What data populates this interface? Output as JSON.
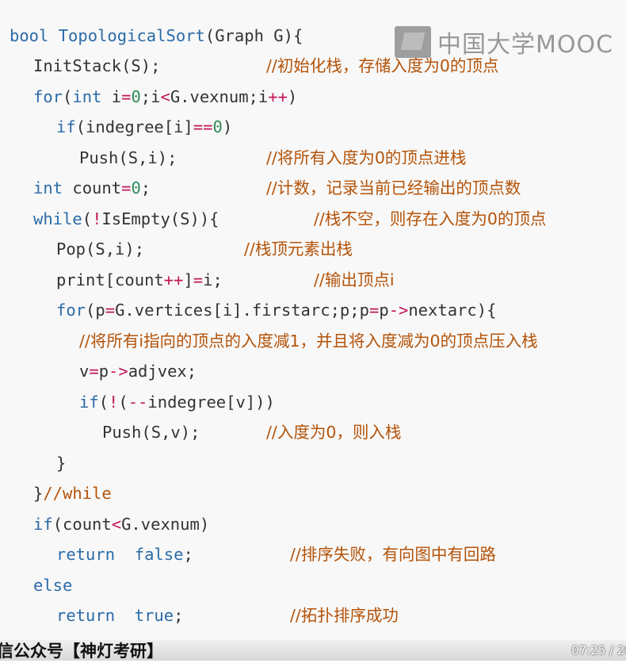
{
  "watermark": {
    "text": "中国大学MOOC"
  },
  "code": {
    "l1_kw": "bool",
    "l1_fn": "TopologicalSort",
    "l1_rest": "(Graph G){",
    "l2_code": "InitStack(S);",
    "l2_comment": "//初始化栈，存储入度为0的顶点",
    "l3_kw": "for",
    "l3_p1": "(",
    "l3_kw2": "int",
    "l3_p2": " i",
    "l3_op1": "=",
    "l3_num1": "0",
    "l3_p3": ";i",
    "l3_op2": "<",
    "l3_p4": "G.vexnum;i",
    "l3_op3": "++",
    "l3_p5": ")",
    "l4_kw": "if",
    "l4_p1": "(indegree[i]",
    "l4_op": "==",
    "l4_num": "0",
    "l4_p2": ")",
    "l5_code": "Push(S,i);",
    "l5_comment": "//将所有入度为0的顶点进栈",
    "l6_kw": "int",
    "l6_p1": " count",
    "l6_op": "=",
    "l6_num": "0",
    "l6_p2": ";",
    "l6_comment": "//计数，记录当前已经输出的顶点数",
    "l7_kw": "while",
    "l7_p1": "(",
    "l7_op": "!",
    "l7_p2": "IsEmpty(S)){",
    "l7_comment": "//栈不空，则存在入度为0的顶点",
    "l8_code": "Pop(S,i);",
    "l8_comment": "//栈顶元素出栈",
    "l9_p1": "print[count",
    "l9_op1": "++",
    "l9_p2": "]",
    "l9_op2": "=",
    "l9_p3": "i;",
    "l9_comment": "//输出顶点i",
    "l10_kw": "for",
    "l10_p1": "(p",
    "l10_op1": "=",
    "l10_p2": "G.vertices[i].firstarc;p;p",
    "l10_op2": "=",
    "l10_p3": "p",
    "l10_op3": "->",
    "l10_p4": "nextarc){",
    "l11_comment": "//将所有i指向的顶点的入度减1，并且将入度减为0的顶点压入栈",
    "l12_p1": "v",
    "l12_op1": "=",
    "l12_p2": "p",
    "l12_op2": "->",
    "l12_p3": "adjvex;",
    "l13_kw": "if",
    "l13_p1": "(",
    "l13_op1": "!",
    "l13_p2": "(",
    "l13_op2": "--",
    "l13_p3": "indegree[v]))",
    "l14_code": "Push(S,v);",
    "l14_comment": "//入度为0，则入栈",
    "l15_code": "}",
    "l16_p1": "}",
    "l16_comment": "//while",
    "l17_kw": "if",
    "l17_p1": "(count",
    "l17_op": "<",
    "l17_p2": "G.vexnum)",
    "l18_kw1": "return",
    "l18_kw2": "false",
    "l18_p": ";",
    "l18_comment": "//排序失败，有向图中有回路",
    "l19_kw": "else",
    "l20_kw1": "return",
    "l20_kw2": "true",
    "l20_p": ";",
    "l20_comment": "//拓扑排序成功",
    "l21_code": "}"
  },
  "caption": {
    "text": "信公众号【神灯考研】"
  },
  "player": {
    "timecode": "07:25 / 20"
  }
}
